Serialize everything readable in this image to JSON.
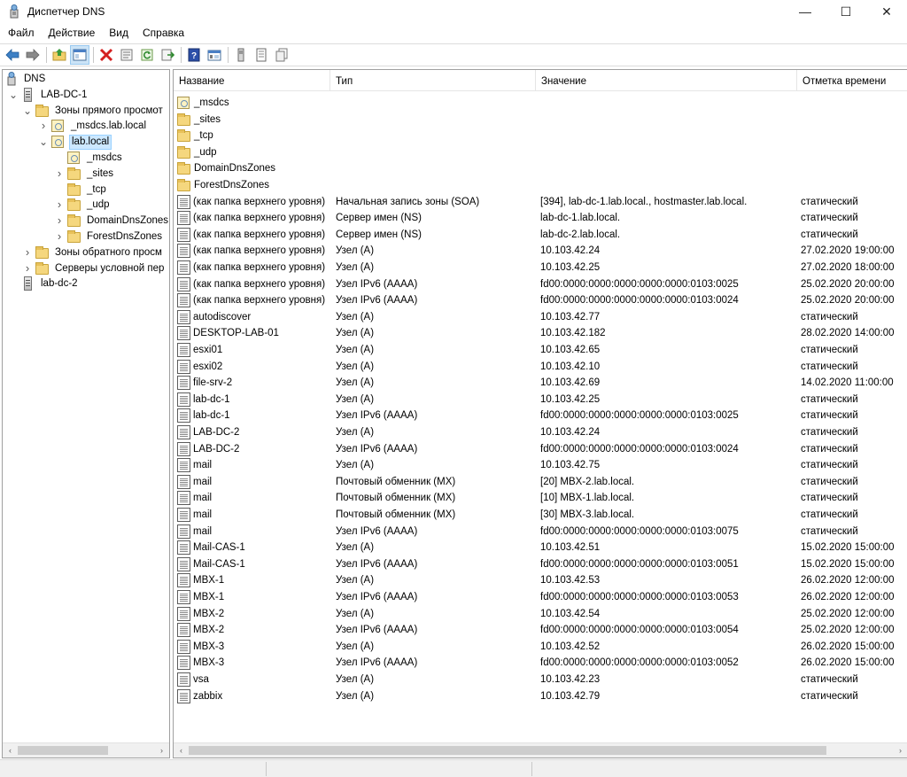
{
  "window": {
    "title": "Диспетчер DNS",
    "minimize_glyph": "—",
    "maximize_glyph": "☐",
    "close_glyph": "✕"
  },
  "menu": [
    "Файл",
    "Действие",
    "Вид",
    "Справка"
  ],
  "toolbar": {
    "icons": [
      "back-arrow-icon",
      "forward-arrow-icon",
      "up-folder-icon",
      "show-hide-tree-icon",
      "delete-icon",
      "properties-icon",
      "refresh-icon",
      "export-list-icon",
      "help-icon",
      "view-icon",
      "server-icon",
      "record-icon",
      "copy-icon"
    ]
  },
  "tree": {
    "items": [
      {
        "label": "DNS",
        "level": 0,
        "icon": "dns-icon",
        "expander": ""
      },
      {
        "label": "LAB-DC-1",
        "level": 1,
        "icon": "server-icon",
        "expander": "expanded"
      },
      {
        "label": "Зоны прямого просмот",
        "level": 2,
        "icon": "folder-icon",
        "expander": "expanded"
      },
      {
        "label": "_msdcs.lab.local",
        "level": 3,
        "icon": "zone-icon",
        "expander": "collapsed"
      },
      {
        "label": "lab.local",
        "level": 3,
        "icon": "zone-icon",
        "expander": "expanded",
        "selected": true
      },
      {
        "label": "_msdcs",
        "level": 4,
        "icon": "zone-icon",
        "expander": ""
      },
      {
        "label": "_sites",
        "level": 4,
        "icon": "folder-icon",
        "expander": "collapsed"
      },
      {
        "label": "_tcp",
        "level": 4,
        "icon": "folder-icon",
        "expander": ""
      },
      {
        "label": "_udp",
        "level": 4,
        "icon": "folder-icon",
        "expander": "collapsed"
      },
      {
        "label": "DomainDnsZones",
        "level": 4,
        "icon": "folder-icon",
        "expander": "collapsed"
      },
      {
        "label": "ForestDnsZones",
        "level": 4,
        "icon": "folder-icon",
        "expander": "collapsed"
      },
      {
        "label": "Зоны обратного просм",
        "level": 2,
        "icon": "folder-icon",
        "expander": "collapsed"
      },
      {
        "label": "Серверы условной пер",
        "level": 2,
        "icon": "folder-icon",
        "expander": "collapsed"
      },
      {
        "label": "lab-dc-2",
        "level": 1,
        "icon": "server-icon",
        "expander": ""
      }
    ]
  },
  "list": {
    "columns": [
      "Название",
      "Тип",
      "Значение",
      "Отметка времени"
    ],
    "rows": [
      {
        "icon": "zone",
        "name": "_msdcs",
        "type": "",
        "value": "",
        "time": ""
      },
      {
        "icon": "folder",
        "name": "_sites",
        "type": "",
        "value": "",
        "time": ""
      },
      {
        "icon": "folder",
        "name": "_tcp",
        "type": "",
        "value": "",
        "time": ""
      },
      {
        "icon": "folder",
        "name": "_udp",
        "type": "",
        "value": "",
        "time": ""
      },
      {
        "icon": "folder",
        "name": "DomainDnsZones",
        "type": "",
        "value": "",
        "time": ""
      },
      {
        "icon": "folder",
        "name": "ForestDnsZones",
        "type": "",
        "value": "",
        "time": ""
      },
      {
        "icon": "record",
        "name": "(как папка верхнего уровня)",
        "type": "Начальная запись зоны (SOA)",
        "value": "[394], lab-dc-1.lab.local., hostmaster.lab.local.",
        "time": "статический"
      },
      {
        "icon": "record",
        "name": "(как папка верхнего уровня)",
        "type": "Сервер имен (NS)",
        "value": "lab-dc-1.lab.local.",
        "time": "статический"
      },
      {
        "icon": "record",
        "name": "(как папка верхнего уровня)",
        "type": "Сервер имен (NS)",
        "value": "lab-dc-2.lab.local.",
        "time": "статический"
      },
      {
        "icon": "record",
        "name": "(как папка верхнего уровня)",
        "type": "Узел (A)",
        "value": "10.103.42.24",
        "time": "27.02.2020 19:00:00"
      },
      {
        "icon": "record",
        "name": "(как папка верхнего уровня)",
        "type": "Узел (A)",
        "value": "10.103.42.25",
        "time": "27.02.2020 18:00:00"
      },
      {
        "icon": "record",
        "name": "(как папка верхнего уровня)",
        "type": "Узел IPv6 (AAAA)",
        "value": "fd00:0000:0000:0000:0000:0000:0103:0025",
        "time": "25.02.2020 20:00:00"
      },
      {
        "icon": "record",
        "name": "(как папка верхнего уровня)",
        "type": "Узел IPv6 (AAAA)",
        "value": "fd00:0000:0000:0000:0000:0000:0103:0024",
        "time": "25.02.2020 20:00:00"
      },
      {
        "icon": "record",
        "name": "autodiscover",
        "type": "Узел (A)",
        "value": "10.103.42.77",
        "time": "статический"
      },
      {
        "icon": "record",
        "name": "DESKTOP-LAB-01",
        "type": "Узел (A)",
        "value": "10.103.42.182",
        "time": "28.02.2020 14:00:00"
      },
      {
        "icon": "record",
        "name": "esxi01",
        "type": "Узел (A)",
        "value": "10.103.42.65",
        "time": "статический"
      },
      {
        "icon": "record",
        "name": "esxi02",
        "type": "Узел (A)",
        "value": "10.103.42.10",
        "time": "статический"
      },
      {
        "icon": "record",
        "name": "file-srv-2",
        "type": "Узел (A)",
        "value": "10.103.42.69",
        "time": "14.02.2020 11:00:00"
      },
      {
        "icon": "record",
        "name": "lab-dc-1",
        "type": "Узел (A)",
        "value": "10.103.42.25",
        "time": "статический"
      },
      {
        "icon": "record",
        "name": "lab-dc-1",
        "type": "Узел IPv6 (AAAA)",
        "value": "fd00:0000:0000:0000:0000:0000:0103:0025",
        "time": "статический"
      },
      {
        "icon": "record",
        "name": "LAB-DC-2",
        "type": "Узел (A)",
        "value": "10.103.42.24",
        "time": "статический"
      },
      {
        "icon": "record",
        "name": "LAB-DC-2",
        "type": "Узел IPv6 (AAAA)",
        "value": "fd00:0000:0000:0000:0000:0000:0103:0024",
        "time": "статический"
      },
      {
        "icon": "record",
        "name": "mail",
        "type": "Узел (A)",
        "value": "10.103.42.75",
        "time": "статический"
      },
      {
        "icon": "record",
        "name": "mail",
        "type": "Почтовый обменник (MX)",
        "value": "[20]  MBX-2.lab.local.",
        "time": "статический"
      },
      {
        "icon": "record",
        "name": "mail",
        "type": "Почтовый обменник (MX)",
        "value": "[10]  MBX-1.lab.local.",
        "time": "статический"
      },
      {
        "icon": "record",
        "name": "mail",
        "type": "Почтовый обменник (MX)",
        "value": "[30]  MBX-3.lab.local.",
        "time": "статический"
      },
      {
        "icon": "record",
        "name": "mail",
        "type": "Узел IPv6 (AAAA)",
        "value": "fd00:0000:0000:0000:0000:0000:0103:0075",
        "time": "статический"
      },
      {
        "icon": "record",
        "name": "Mail-CAS-1",
        "type": "Узел (A)",
        "value": "10.103.42.51",
        "time": "15.02.2020 15:00:00"
      },
      {
        "icon": "record",
        "name": "Mail-CAS-1",
        "type": "Узел IPv6 (AAAA)",
        "value": "fd00:0000:0000:0000:0000:0000:0103:0051",
        "time": "15.02.2020 15:00:00"
      },
      {
        "icon": "record",
        "name": "MBX-1",
        "type": "Узел (A)",
        "value": "10.103.42.53",
        "time": "26.02.2020 12:00:00"
      },
      {
        "icon": "record",
        "name": "MBX-1",
        "type": "Узел IPv6 (AAAA)",
        "value": "fd00:0000:0000:0000:0000:0000:0103:0053",
        "time": "26.02.2020 12:00:00"
      },
      {
        "icon": "record",
        "name": "MBX-2",
        "type": "Узел (A)",
        "value": "10.103.42.54",
        "time": "25.02.2020 12:00:00"
      },
      {
        "icon": "record",
        "name": "MBX-2",
        "type": "Узел IPv6 (AAAA)",
        "value": "fd00:0000:0000:0000:0000:0000:0103:0054",
        "time": "25.02.2020 12:00:00"
      },
      {
        "icon": "record",
        "name": "MBX-3",
        "type": "Узел (A)",
        "value": "10.103.42.52",
        "time": "26.02.2020 15:00:00"
      },
      {
        "icon": "record",
        "name": "MBX-3",
        "type": "Узел IPv6 (AAAA)",
        "value": "fd00:0000:0000:0000:0000:0000:0103:0052",
        "time": "26.02.2020 15:00:00"
      },
      {
        "icon": "record",
        "name": "vsa",
        "type": "Узел (A)",
        "value": "10.103.42.23",
        "time": "статический"
      },
      {
        "icon": "record",
        "name": "zabbix",
        "type": "Узел (A)",
        "value": "10.103.42.79",
        "time": "статический"
      }
    ]
  },
  "scroll": {
    "left_arrow": "‹",
    "right_arrow": "›"
  }
}
